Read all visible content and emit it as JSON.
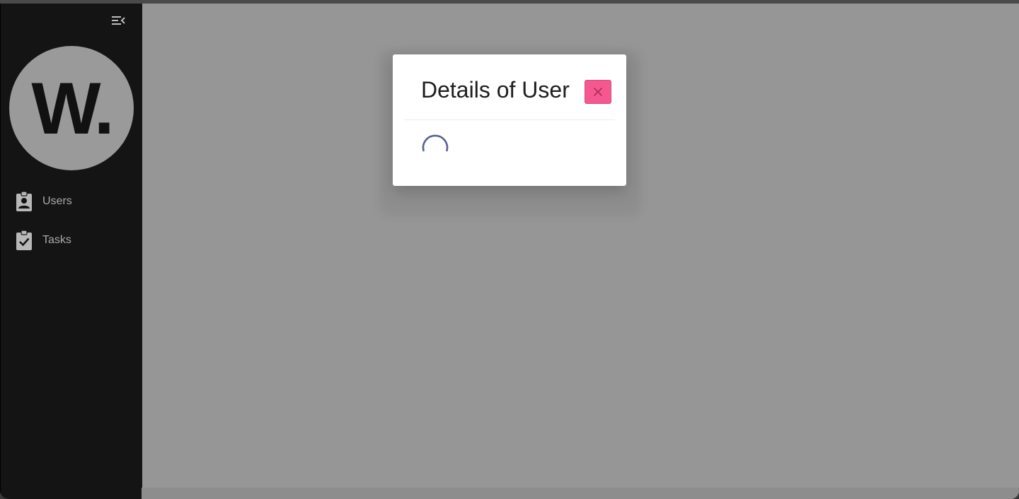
{
  "sidebar": {
    "logo_text": "W.",
    "collapse_icon": "menu-collapse-icon",
    "items": [
      {
        "label": "Users",
        "icon": "badge-icon"
      },
      {
        "label": "Tasks",
        "icon": "clipboard-check-icon"
      }
    ]
  },
  "dialog": {
    "title": "Details of User",
    "close_icon": "close-icon",
    "loading": true
  },
  "colors": {
    "sidebar_bg": "#141414",
    "overlay_bg": "#969696",
    "close_button": "#f5588e",
    "spinner": "#5b6196"
  }
}
